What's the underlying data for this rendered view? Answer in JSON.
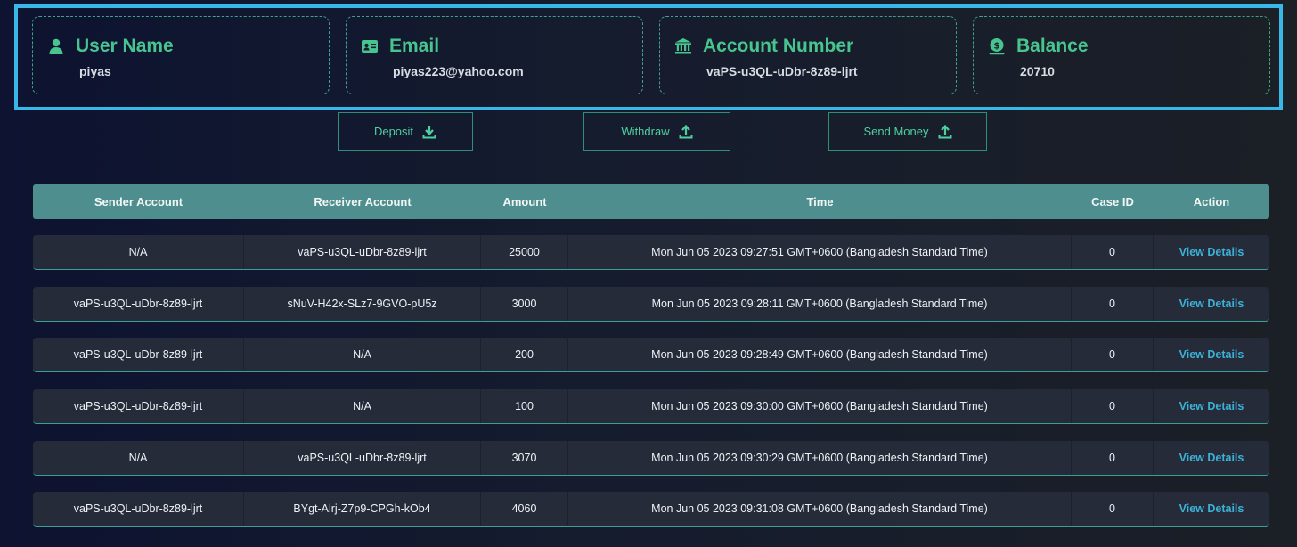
{
  "cards": [
    {
      "title": "User Name",
      "value": "piyas",
      "icon": "user-icon"
    },
    {
      "title": "Email",
      "value": "piyas223@yahoo.com",
      "icon": "id-card-icon"
    },
    {
      "title": "Account Number",
      "value": "vaPS-u3QL-uDbr-8z89-ljrt",
      "icon": "bank-icon"
    },
    {
      "title": "Balance",
      "value": "20710",
      "icon": "money-icon"
    }
  ],
  "actions": {
    "deposit": "Deposit",
    "withdraw": "Withdraw",
    "send_money": "Send Money"
  },
  "table": {
    "headers": [
      "Sender Account",
      "Receiver Account",
      "Amount",
      "Time",
      "Case ID",
      "Action"
    ],
    "rows": [
      {
        "sender": "N/A",
        "receiver": "vaPS-u3QL-uDbr-8z89-ljrt",
        "amount": "25000",
        "time": "Mon Jun 05 2023 09:27:51 GMT+0600 (Bangladesh Standard Time)",
        "case_id": "0",
        "action": "View Details"
      },
      {
        "sender": "vaPS-u3QL-uDbr-8z89-ljrt",
        "receiver": "sNuV-H42x-SLz7-9GVO-pU5z",
        "amount": "3000",
        "time": "Mon Jun 05 2023 09:28:11 GMT+0600 (Bangladesh Standard Time)",
        "case_id": "0",
        "action": "View Details"
      },
      {
        "sender": "vaPS-u3QL-uDbr-8z89-ljrt",
        "receiver": "N/A",
        "amount": "200",
        "time": "Mon Jun 05 2023 09:28:49 GMT+0600 (Bangladesh Standard Time)",
        "case_id": "0",
        "action": "View Details"
      },
      {
        "sender": "vaPS-u3QL-uDbr-8z89-ljrt",
        "receiver": "N/A",
        "amount": "100",
        "time": "Mon Jun 05 2023 09:30:00 GMT+0600 (Bangladesh Standard Time)",
        "case_id": "0",
        "action": "View Details"
      },
      {
        "sender": "N/A",
        "receiver": "vaPS-u3QL-uDbr-8z89-ljrt",
        "amount": "3070",
        "time": "Mon Jun 05 2023 09:30:29 GMT+0600 (Bangladesh Standard Time)",
        "case_id": "0",
        "action": "View Details"
      },
      {
        "sender": "vaPS-u3QL-uDbr-8z89-ljrt",
        "receiver": "BYgt-Alrj-Z7p9-CPGh-kOb4",
        "amount": "4060",
        "time": "Mon Jun 05 2023 09:31:08 GMT+0600 (Bangladesh Standard Time)",
        "case_id": "0",
        "action": "View Details"
      }
    ]
  },
  "colors": {
    "accent": "#48c48f",
    "frame": "#38b8e8",
    "header_bg": "#4e8e8e",
    "link": "#3cb1d6"
  }
}
